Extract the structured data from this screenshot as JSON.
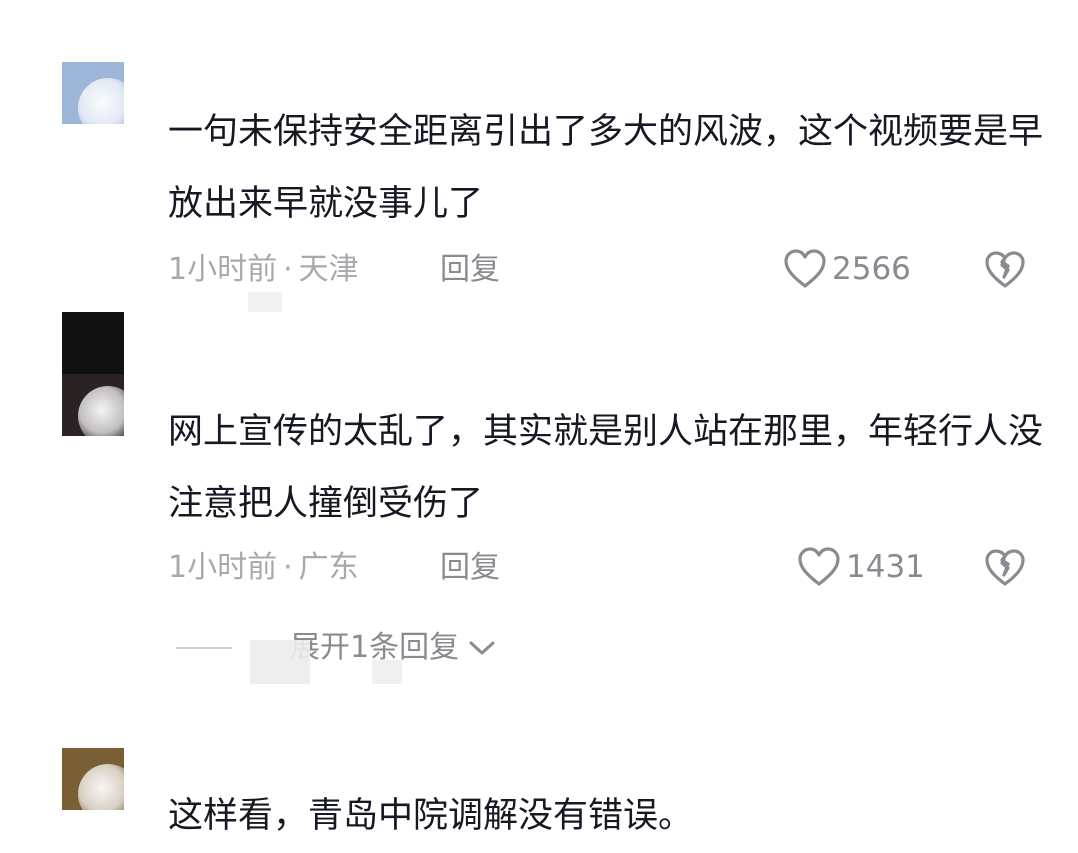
{
  "comments": [
    {
      "text": "一句未保持安全距离引出了多大的风波，这个视频要是早放出来早就没事儿了",
      "time": "1小时前",
      "location": "天津",
      "reply_label": "回复",
      "likes": "2566"
    },
    {
      "text": "网上宣传的太乱了，其实就是别人站在那里，年轻行人没注意把人撞倒受伤了",
      "time": "1小时前",
      "location": "广东",
      "reply_label": "回复",
      "likes": "1431"
    },
    {
      "text": "这样看，青岛中院调解没有错误。"
    }
  ],
  "expand_replies_label": "展开1条回复",
  "meta_separator": "·",
  "colors": {
    "text_primary": "#161823",
    "text_secondary": "#a8a9ad",
    "icon": "#8a8b91"
  },
  "icons": [
    "heart-outline-icon",
    "broken-heart-icon",
    "chevron-down-icon"
  ]
}
